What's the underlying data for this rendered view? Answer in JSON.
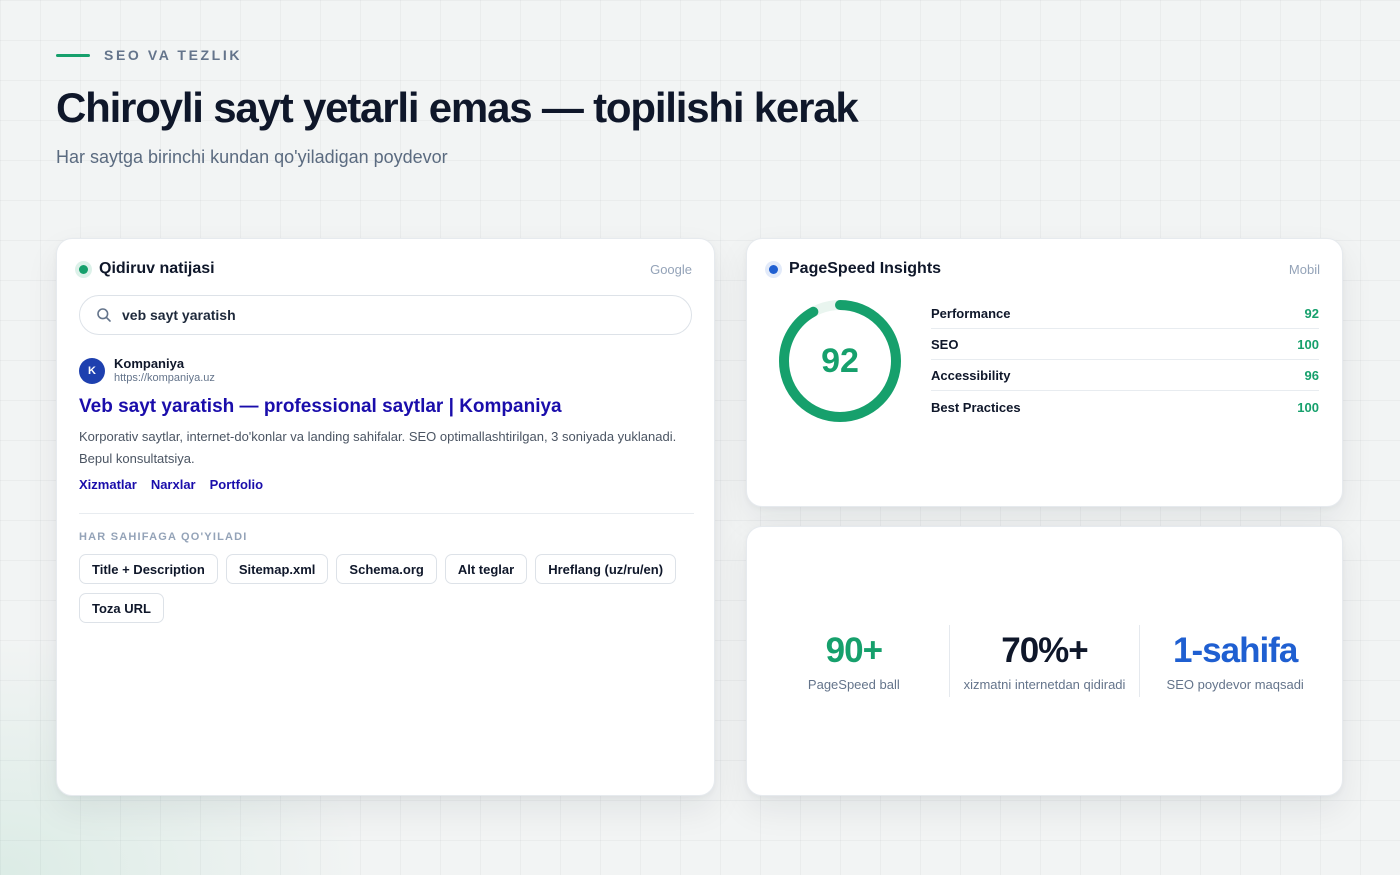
{
  "header": {
    "eyebrow": "SEO VA TEZLIK",
    "title": "Chiroyli sayt yetarli emas — topilishi kerak",
    "subtitle": "Har saytga birinchi kundan qo'yiladigan poydevor"
  },
  "search_card": {
    "title": "Qidiruv natijasi",
    "tag": "Google",
    "query": "veb sayt yaratish",
    "result": {
      "favicon_letter": "K",
      "site_name": "Kompaniya",
      "url": "https://kompaniya.uz",
      "title": "Veb sayt yaratish — professional saytlar | Kompaniya",
      "description": "Korporativ saytlar, internet-do'konlar va landing sahifalar. SEO optimallashtirilgan, 3 soniyada yuklanadi. Bepul konsultatsiya.",
      "sitelinks": [
        "Xizmatlar",
        "Narxlar",
        "Portfolio"
      ]
    },
    "section_label": "HAR SAHIFAGA QO'YILADI",
    "chips": [
      "Title + Description",
      "Sitemap.xml",
      "Schema.org",
      "Alt teglar",
      "Hreflang (uz/ru/en)",
      "Toza URL"
    ]
  },
  "pagespeed_card": {
    "title": "PageSpeed Insights",
    "tag": "Mobil",
    "score": 92,
    "score_max": 100,
    "metrics": [
      {
        "label": "Performance",
        "value": "92"
      },
      {
        "label": "SEO",
        "value": "100"
      },
      {
        "label": "Accessibility",
        "value": "96"
      },
      {
        "label": "Best Practices",
        "value": "100"
      }
    ]
  },
  "stats_card": {
    "stats": [
      {
        "value": "90+",
        "label": "PageSpeed ball",
        "color": "#16a06c"
      },
      {
        "value": "70%+",
        "label": "xizmatni internetdan qidiradi",
        "color": "#0f172a"
      },
      {
        "value": "1-sahifa",
        "label": "SEO poydevor maqsadi",
        "color": "#1f5fd1"
      }
    ]
  },
  "colors": {
    "accent_green": "#16a06c",
    "accent_blue": "#1f5fd1",
    "link_blue": "#1a0dab",
    "text_dark": "#0f172a"
  }
}
